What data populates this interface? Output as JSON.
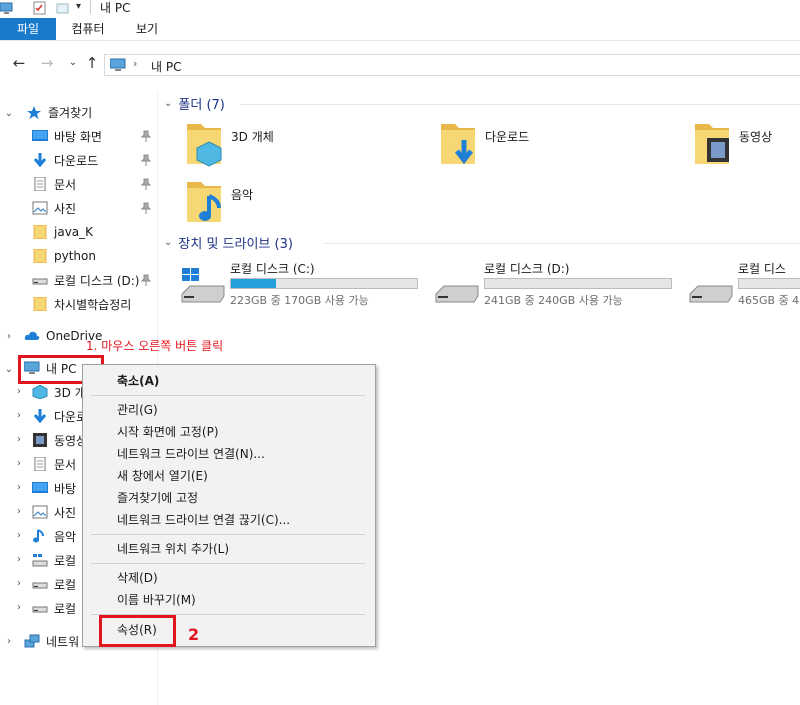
{
  "window": {
    "title": "내 PC"
  },
  "ribbon": {
    "tabs": [
      "파일",
      "컴퓨터",
      "보기"
    ]
  },
  "address": {
    "path": "내 PC"
  },
  "nav": {
    "quick_access_label": "즐겨찾기",
    "quick_access_items": [
      {
        "label": "바탕 화면",
        "icon": "desktop-icon",
        "pinned": true
      },
      {
        "label": "다운로드",
        "icon": "download-icon",
        "pinned": true
      },
      {
        "label": "문서",
        "icon": "document-icon",
        "pinned": true
      },
      {
        "label": "사진",
        "icon": "pictures-icon",
        "pinned": true
      },
      {
        "label": "java_K",
        "icon": "folder-icon",
        "pinned": false
      },
      {
        "label": "python",
        "icon": "folder-icon",
        "pinned": false
      },
      {
        "label": "로컬 디스크 (D:)",
        "icon": "drive-icon",
        "pinned": true
      },
      {
        "label": "차시별학습정리",
        "icon": "folder-icon",
        "pinned": false
      }
    ],
    "onedrive_label": "OneDrive",
    "thispc_label": "내 PC",
    "thispc_children": [
      {
        "label": "3D 개",
        "icon": "3d-objects-icon"
      },
      {
        "label": "다운로",
        "icon": "download-icon"
      },
      {
        "label": "동영상",
        "icon": "video-icon"
      },
      {
        "label": "문서",
        "icon": "document-icon"
      },
      {
        "label": "바탕",
        "icon": "desktop-icon"
      },
      {
        "label": "사진",
        "icon": "pictures-icon"
      },
      {
        "label": "음악",
        "icon": "music-icon"
      },
      {
        "label": "로컬",
        "icon": "windows-drive-icon"
      },
      {
        "label": "로컬",
        "icon": "drive-icon"
      },
      {
        "label": "로컬",
        "icon": "drive-icon"
      }
    ],
    "network_label": "네트워"
  },
  "main": {
    "folders_header": "폴더 (7)",
    "folders": [
      {
        "label": "3D 개체",
        "icon": "3d-objects-folder-icon"
      },
      {
        "label": "다운로드",
        "icon": "downloads-folder-icon"
      },
      {
        "label": "동영상",
        "icon": "videos-folder-icon"
      },
      {
        "label": "음악",
        "icon": "music-folder-icon"
      }
    ],
    "drives_header": "장치 및 드라이브 (3)",
    "drives": [
      {
        "label": "로컬 디스크 (C:)",
        "space": "223GB 중 170GB 사용 가능",
        "used_fraction": 0.24
      },
      {
        "label": "로컬 디스크 (D:)",
        "space": "241GB 중 240GB 사용 가능",
        "used_fraction": 0.0
      },
      {
        "label": "로컬 디스",
        "space": "465GB 중 4",
        "used_fraction": 0.0
      }
    ]
  },
  "context_menu": {
    "groups": [
      [
        "축소(A)"
      ],
      [
        "관리(G)",
        "시작 화면에 고정(P)",
        "네트워크 드라이브 연결(N)...",
        "새 창에서 열기(E)",
        "즐겨찾기에 고정",
        "네트워크 드라이브 연결 끊기(C)..."
      ],
      [
        "네트워크 위치 추가(L)"
      ],
      [
        "삭제(D)",
        "이름 바꾸기(M)"
      ],
      [
        "속성(R)"
      ]
    ]
  },
  "annotations": {
    "step1": "1. 마우스 오른쪽 버튼 클릭",
    "step2": "2"
  },
  "colors": {
    "accent": "#1979ca",
    "header_text": "#1e3287",
    "annotation": "#e2161e",
    "drive_fill": "#26a0da"
  }
}
